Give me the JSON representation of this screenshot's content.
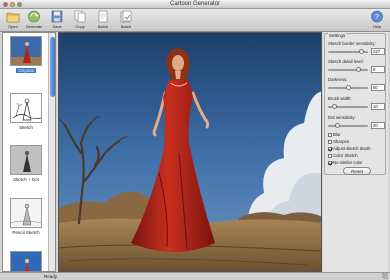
{
  "window": {
    "title": "Cartoon Generator"
  },
  "toolbar": {
    "buttons": [
      {
        "label": "Open",
        "icon": "folder-icon"
      },
      {
        "label": "Generate",
        "icon": "generate-icon"
      },
      {
        "label": "Save",
        "icon": "save-icon"
      },
      {
        "label": "Copy",
        "icon": "copy-icon"
      },
      {
        "label": "Batch",
        "icon": "batch-icon"
      },
      {
        "label": "Help",
        "icon": "help-icon"
      }
    ]
  },
  "sidebar": {
    "items": [
      {
        "label": "Original",
        "selected": true
      },
      {
        "label": "Sketch",
        "selected": false
      },
      {
        "label": "Sketch + Dot",
        "selected": false
      },
      {
        "label": "Pencil Sketch",
        "selected": false
      },
      {
        "label": "",
        "selected": false
      }
    ]
  },
  "settings": {
    "title": "Settings",
    "sliders": [
      {
        "label": "Sketch border sensitivity:",
        "value": "227",
        "level": 0.89
      },
      {
        "label": "Sketch detail level:",
        "value": "8",
        "level": 0.8
      },
      {
        "label": "Darkness:",
        "value": "50",
        "level": 0.5
      },
      {
        "label": "Brush width:",
        "value": "10",
        "level": 0.1
      },
      {
        "label": "Dot sensitivity:",
        "value": "20",
        "level": 0.2
      }
    ],
    "checkboxes": [
      {
        "label": "Blur",
        "checked": false
      },
      {
        "label": "Sharpen",
        "checked": false
      },
      {
        "label": "Adjust sketch depth",
        "checked": true
      },
      {
        "label": "Color Sketch",
        "checked": false
      },
      {
        "label": "No similar color",
        "checked": true
      }
    ],
    "reset_label": "Reset"
  },
  "status": {
    "text": "Ready"
  },
  "colors": {
    "selection": "#3b74c8",
    "sky": "#2a4a6e",
    "dress": "#b8221c"
  }
}
